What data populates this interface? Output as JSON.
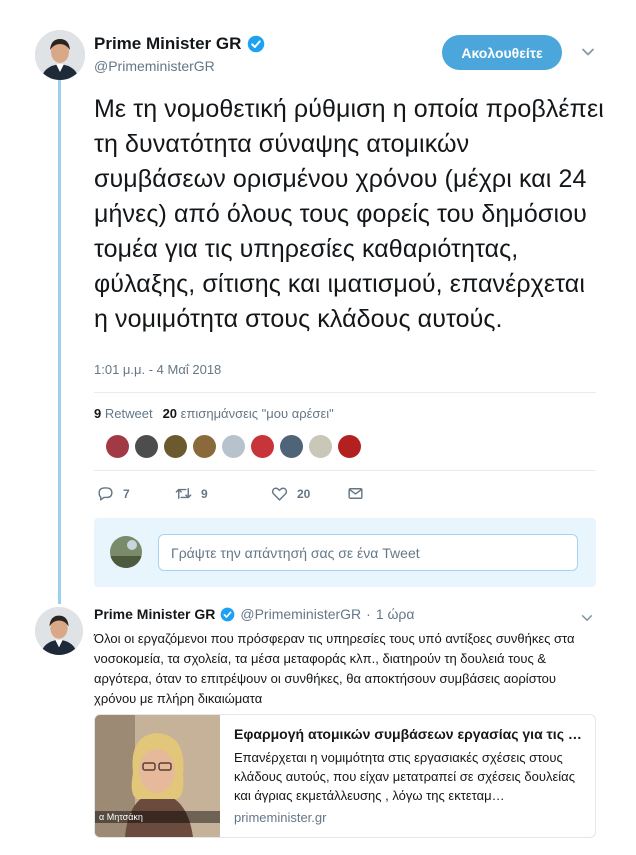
{
  "tweet": {
    "author": "Prime Minister GR",
    "handle": "@PrimeministerGR",
    "follow_label": "Ακολουθείτε",
    "text": "Με τη νομοθετική ρύθμιση η οποία προβλέπει τη δυνατότητα σύναψης ατομικών συμβάσεων ορισμένου χρόνου (μέχρι και 24 μήνες) από όλους τους φορείς του δημόσιου τομέα για τις υπηρεσίες καθαριότητας, φύλαξης, σίτισης και ιματισμού, επανέρχεται η νομιμότητα στους κλάδους αυτούς.",
    "timestamp": "1:01 μ.μ. - 4 Μαΐ 2018",
    "retweet_count": "9",
    "retweet_label": "Retweet",
    "like_count": "20",
    "like_label": "επισημάνσεις \"μου αρέσει\"",
    "actions": {
      "reply_count": "7",
      "retweet_count": "9",
      "like_count": "20"
    }
  },
  "reply_box": {
    "placeholder": "Γράψτε την απάντησή σας σε ένα Tweet"
  },
  "reply": {
    "author": "Prime Minister GR",
    "handle": "@PrimeministerGR",
    "separator": "·",
    "time": "1 ώρα",
    "text": "Όλοι οι εργαζόμενοι που πρόσφεραν τις υπηρεσίες τους υπό αντίξοες συνθήκες στα νοσοκομεία, τα σχολεία, τα μέσα μεταφοράς κλπ., διατηρούν τη δουλειά τους & αργότερα, όταν το επιτρέψουν οι συνθήκες, θα αποκτήσουν συμβάσεις αορίστου χρόνου με πλήρη δικαιώματα",
    "card": {
      "title": "Εφαρμογή ατομικών συμβάσεων εργασίας για τις …",
      "description": "Επανέρχεται η νομιμότητα στις εργασιακές σχέσεις στους κλάδους αυτούς, που είχαν μετατραπεί σε σχέσεις δουλείας και άγριας εκμετάλλευσης , λόγω της εκτεταμ…",
      "domain": "primeminister.gr",
      "image_caption": "α Μητσάκη"
    }
  },
  "colors": {
    "accent": "#1da1f2",
    "follow_bg": "#4ba6dc",
    "thread_line": "#9ad1ee",
    "muted": "#657786"
  }
}
